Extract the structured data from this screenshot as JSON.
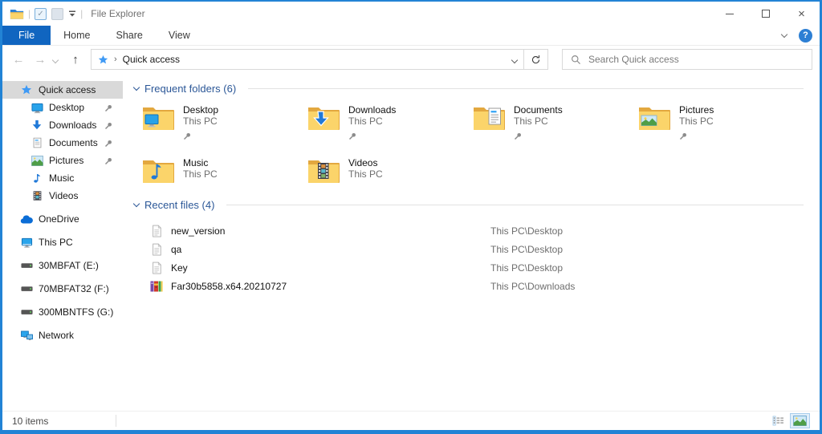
{
  "titlebar": {
    "title": "File Explorer",
    "qat_check_glyph": "✓",
    "icons": [
      "explorer-folder-icon",
      "qat-checkbox-icon",
      "qat-newfolder-icon",
      "qat-customize-icon"
    ],
    "controls": [
      "minimize",
      "maximize",
      "close"
    ]
  },
  "ribbon": {
    "tabs": [
      {
        "label": "File",
        "active": true
      },
      {
        "label": "Home",
        "active": false
      },
      {
        "label": "Share",
        "active": false
      },
      {
        "label": "View",
        "active": false
      }
    ],
    "help_glyph": "?"
  },
  "nav": {
    "back_glyph": "←",
    "forward_glyph": "→",
    "up_glyph": "↑",
    "address_location": "Quick access",
    "breadcrumb_chevron": "›",
    "search_placeholder": "Search Quick access"
  },
  "sidebar": {
    "items": [
      {
        "label": "Quick access",
        "icon": "quick-access-star-icon",
        "level": 0,
        "selected": true,
        "pinned": false,
        "group": false
      },
      {
        "label": "Desktop",
        "icon": "desktop-monitor-icon",
        "level": 1,
        "selected": false,
        "pinned": true,
        "group": false
      },
      {
        "label": "Downloads",
        "icon": "download-arrow-icon",
        "level": 1,
        "selected": false,
        "pinned": true,
        "group": false
      },
      {
        "label": "Documents",
        "icon": "document-page-icon",
        "level": 1,
        "selected": false,
        "pinned": true,
        "group": false
      },
      {
        "label": "Pictures",
        "icon": "picture-photo-icon",
        "level": 1,
        "selected": false,
        "pinned": true,
        "group": false
      },
      {
        "label": "Music",
        "icon": "music-note-icon",
        "level": 1,
        "selected": false,
        "pinned": false,
        "group": false
      },
      {
        "label": "Videos",
        "icon": "video-film-icon",
        "level": 1,
        "selected": false,
        "pinned": false,
        "group": false
      },
      {
        "label": "OneDrive",
        "icon": "onedrive-cloud-icon",
        "level": 0,
        "selected": false,
        "pinned": false,
        "group": true
      },
      {
        "label": "This PC",
        "icon": "computer-monitor-icon",
        "level": 0,
        "selected": false,
        "pinned": false,
        "group": true
      },
      {
        "label": "30MBFAT (E:)",
        "icon": "hard-drive-icon",
        "level": 0,
        "selected": false,
        "pinned": false,
        "group": true
      },
      {
        "label": "70MBFAT32 (F:)",
        "icon": "hard-drive-icon",
        "level": 0,
        "selected": false,
        "pinned": false,
        "group": true
      },
      {
        "label": "300MBNTFS (G:)",
        "icon": "hard-drive-icon",
        "level": 0,
        "selected": false,
        "pinned": false,
        "group": true
      },
      {
        "label": "Network",
        "icon": "network-computers-icon",
        "level": 0,
        "selected": false,
        "pinned": false,
        "group": true
      }
    ]
  },
  "main": {
    "frequent": {
      "title": "Frequent folders (6)",
      "tiles": [
        {
          "name": "Desktop",
          "location": "This PC",
          "pinned": true,
          "icon": "folder-desktop-icon"
        },
        {
          "name": "Downloads",
          "location": "This PC",
          "pinned": true,
          "icon": "folder-downloads-icon"
        },
        {
          "name": "Documents",
          "location": "This PC",
          "pinned": true,
          "icon": "folder-documents-icon"
        },
        {
          "name": "Pictures",
          "location": "This PC",
          "pinned": true,
          "icon": "folder-pictures-icon"
        },
        {
          "name": "Music",
          "location": "This PC",
          "pinned": false,
          "icon": "folder-music-icon"
        },
        {
          "name": "Videos",
          "location": "This PC",
          "pinned": false,
          "icon": "folder-videos-icon"
        }
      ]
    },
    "recent": {
      "title": "Recent files (4)",
      "files": [
        {
          "name": "new_version",
          "path": "This PC\\Desktop",
          "icon": "text-file-icon"
        },
        {
          "name": "qa",
          "path": "This PC\\Desktop",
          "icon": "text-file-icon"
        },
        {
          "name": "Key",
          "path": "This PC\\Desktop",
          "icon": "text-file-icon"
        },
        {
          "name": "Far30b5858.x64.20210727",
          "path": "This PC\\Downloads",
          "icon": "winrar-archive-icon"
        }
      ]
    }
  },
  "statusbar": {
    "count": "10 items",
    "view_icons": [
      "details-view-icon",
      "thumbnails-view-icon"
    ]
  },
  "colors": {
    "accent_border": "#2283d5",
    "active_tab": "#1065c0",
    "section_title": "#2b5797",
    "selected_sidebar": "#d9d9d9"
  }
}
